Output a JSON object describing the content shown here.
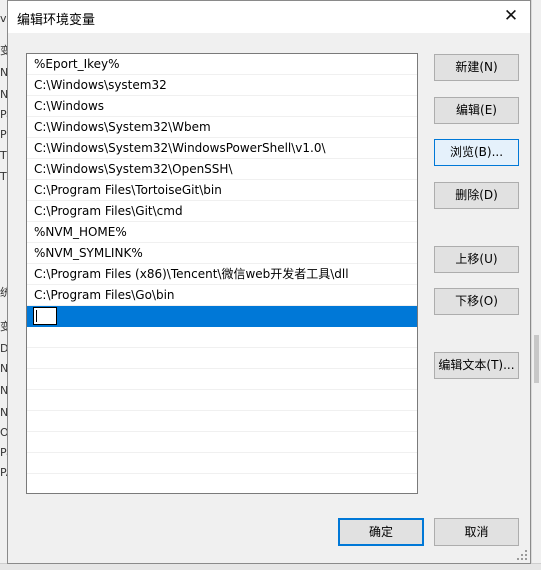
{
  "dialog": {
    "title": "编辑环境变量",
    "close_glyph": "✕"
  },
  "paths": [
    "%Eport_Ikey%",
    "C:\\Windows\\system32",
    "C:\\Windows",
    "C:\\Windows\\System32\\Wbem",
    "C:\\Windows\\System32\\WindowsPowerShell\\v1.0\\",
    "C:\\Windows\\System32\\OpenSSH\\",
    "C:\\Program Files\\TortoiseGit\\bin",
    "C:\\Program Files\\Git\\cmd",
    "%NVM_HOME%",
    "%NVM_SYMLINK%",
    "C:\\Program Files (x86)\\Tencent\\微信web开发者工具\\dll",
    "C:\\Program Files\\Go\\bin",
    ""
  ],
  "selected_index": 12,
  "buttons": {
    "new": "新建(N)",
    "edit": "编辑(E)",
    "browse": "浏览(B)...",
    "delete": "删除(D)",
    "move_up": "上移(U)",
    "move_down": "下移(O)",
    "edit_text": "编辑文本(T)...",
    "ok": "确定",
    "cancel": "取消"
  },
  "background": {
    "left_fragments": [
      "vi",
      "变",
      "NV",
      "NV",
      "Pa",
      "PF",
      "TE",
      "TM",
      "统",
      "变",
      "Dr",
      "NV",
      "NV",
      "NV",
      "OS",
      "Pa",
      "PA"
    ]
  }
}
